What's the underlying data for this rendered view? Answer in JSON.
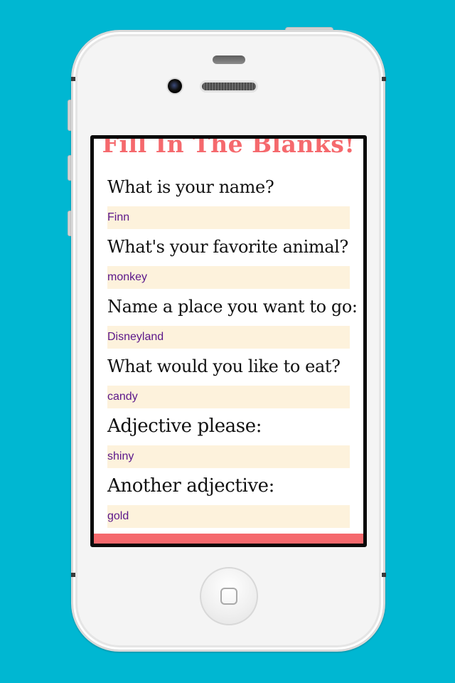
{
  "app": {
    "title": "Fill In The Blanks!",
    "colors": {
      "background": "#00b7d2",
      "accent": "#f5696d",
      "answer_fill": "#fdf2dc",
      "answer_text": "#5b168a"
    }
  },
  "form": {
    "fields": [
      {
        "question": "What is your name?",
        "answer": "Finn"
      },
      {
        "question": "What's your favorite animal?",
        "answer": "monkey"
      },
      {
        "question": "Name a place you want to go:",
        "answer": "Disneyland"
      },
      {
        "question": "What would you like to eat?",
        "answer": "candy"
      },
      {
        "question": "Adjective please:",
        "answer": "shiny"
      },
      {
        "question": "Another adjective:",
        "answer": "gold"
      }
    ]
  },
  "device": {
    "icons": {
      "home": "home-square-icon",
      "camera": "front-camera-icon",
      "speaker": "earpiece-speaker-icon"
    }
  }
}
